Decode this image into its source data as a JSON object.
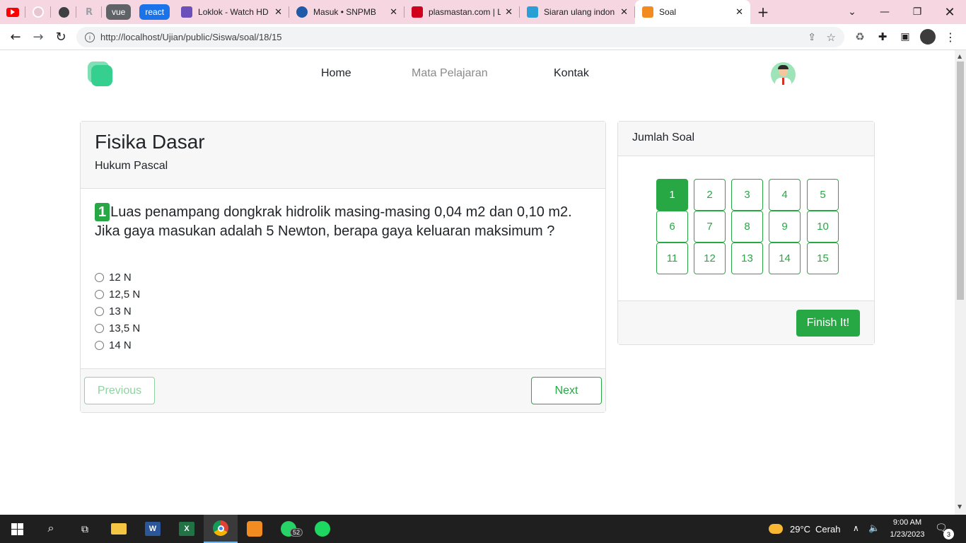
{
  "browser": {
    "pinned_pills": [
      {
        "label": "vue",
        "color": "#5f6368"
      },
      {
        "label": "react",
        "color": "#1a73e8"
      }
    ],
    "tabs": [
      {
        "title": "Loklok - Watch HD",
        "favicon_color": "#6b4fbb"
      },
      {
        "title": "Masuk • SNPMB",
        "favicon_color": "#1e5aa8"
      },
      {
        "title": "plasmastan.com | L",
        "favicon_color": "#d0021b"
      },
      {
        "title": "Siaran ulang indon",
        "favicon_color": "#2a9fd6"
      },
      {
        "title": "Soal",
        "favicon_color": "#f28b20"
      }
    ],
    "url": "http://localhost/Ujian/public/Siswa/soal/18/15"
  },
  "site": {
    "nav": [
      "Home",
      "Mata Pelajaran",
      "Kontak"
    ],
    "subject_title": "Fisika Dasar",
    "topic": "Hukum Pascal",
    "question_number": "1",
    "question_text": "Luas penampang dongkrak hidrolik masing-masing 0,04 m2 dan 0,10 m2. Jika gaya masukan adalah 5 Newton, berapa gaya keluaran maksimum ?",
    "options": [
      "12 N",
      "12,5 N",
      "13 N",
      "13,5 N",
      "14 N"
    ],
    "previous_label": "Previous",
    "next_label": "Next",
    "panel_title": "Jumlah Soal",
    "numbers": [
      "1",
      "2",
      "3",
      "4",
      "5",
      "6",
      "7",
      "8",
      "9",
      "10",
      "11",
      "12",
      "13",
      "14",
      "15"
    ],
    "active_number": "1",
    "finish_label": "Finish It!",
    "accent_color": "#28a745"
  },
  "taskbar": {
    "weather_temp": "29°C",
    "weather_text": "Cerah",
    "time": "9:00 AM",
    "date": "1/23/2023",
    "whatsapp_badge": "52",
    "notification_badge": "3"
  }
}
